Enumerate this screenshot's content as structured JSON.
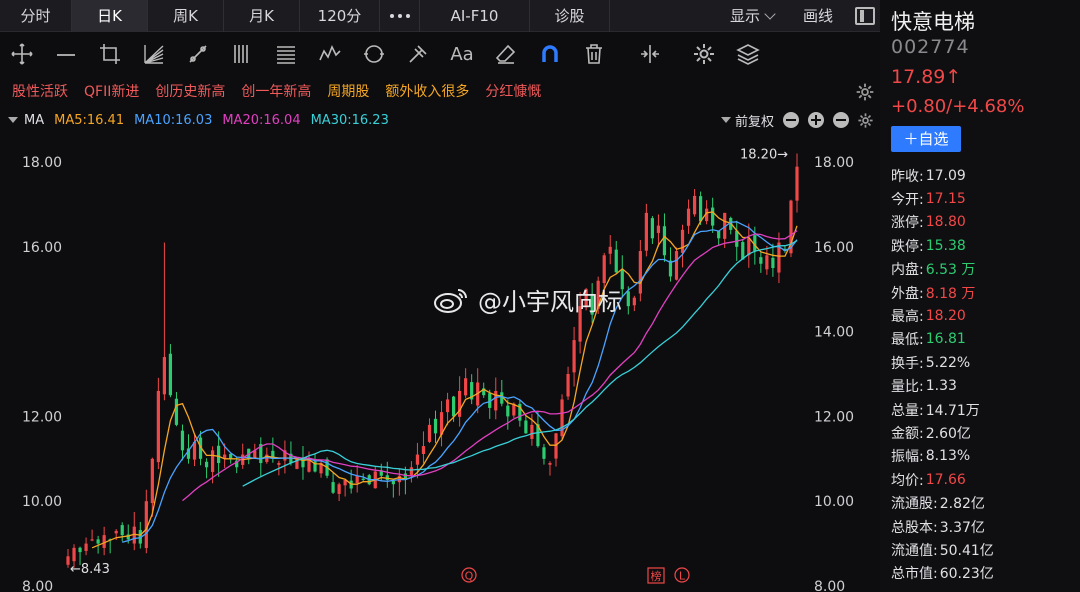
{
  "colors": {
    "up": "#f04848",
    "down": "#2ecc71",
    "ma5": "#f5a623",
    "ma10": "#4aa3ff",
    "ma20": "#e040c0",
    "ma30": "#39d0d8",
    "accent": "#2f7bff",
    "tag": "#f05a5a"
  },
  "tabs": [
    {
      "label": "分时",
      "active": false,
      "w": 72
    },
    {
      "label": "日K",
      "active": true,
      "w": 76
    },
    {
      "label": "周K",
      "active": false,
      "w": 76
    },
    {
      "label": "月K",
      "active": false,
      "w": 76
    },
    {
      "label": "120分",
      "active": false,
      "w": 80
    }
  ],
  "tabs_right": [
    {
      "label": "AI-F10"
    },
    {
      "label": "诊股"
    }
  ],
  "display_label": "显示",
  "draw_label": "画线",
  "toolbar_icons": [
    "crosshair-icon",
    "horizontal-line-icon",
    "crop-icon",
    "fan-icon",
    "pencil-node-icon",
    "parallel-lines-icon",
    "fib-levels-icon",
    "wave-icon",
    "ellipse-icon",
    "pitchfork-icon",
    "text-icon",
    "eraser-icon",
    "magnet-icon",
    "trash-icon",
    "split-icon",
    "gear-icon",
    "layers-icon"
  ],
  "text_tool_label": "Aa",
  "tags": [
    "股性活跃",
    "QFII新进",
    "创历史新高",
    "创一年新高",
    "周期股",
    "额外收入很多",
    "分红慷慨"
  ],
  "ma_row": {
    "label": "MA",
    "items": [
      {
        "text": "MA5:16.41",
        "color": "#f5a623"
      },
      {
        "text": "MA10:16.03",
        "color": "#4aa3ff"
      },
      {
        "text": "MA20:16.04",
        "color": "#e040c0"
      },
      {
        "text": "MA30:16.23",
        "color": "#39d0d8"
      }
    ],
    "adjust": "前复权"
  },
  "watermark": "@小宇风向标",
  "chart_data": {
    "type": "candlestick",
    "y_left_ticks": [
      "18.00",
      "16.00",
      "12.00",
      "10.00",
      "8.00"
    ],
    "y_right_ticks": [
      "18.00",
      "16.00",
      "14.00",
      "12.00",
      "10.00",
      "8.00"
    ],
    "y_tick_values": [
      18,
      16,
      14,
      12,
      10,
      8
    ],
    "ylim": [
      8,
      19
    ],
    "high_label": "18.20→",
    "high_value": 18.2,
    "low_label": "←8.43",
    "low_value": 8.43,
    "markers": [
      "Q",
      "榜",
      "L"
    ],
    "closes": [
      8.7,
      8.9,
      8.8,
      9.0,
      9.1,
      9.0,
      9.2,
      9.1,
      9.3,
      9.2,
      9.1,
      9.4,
      9.0,
      10.0,
      11.0,
      12.6,
      13.4,
      12.5,
      11.8,
      11.2,
      11.0,
      11.4,
      11.0,
      10.8,
      11.2,
      10.9,
      11.1,
      11.0,
      10.8,
      11.1,
      11.0,
      11.2,
      10.9,
      11.1,
      11.0,
      10.9,
      11.2,
      10.9,
      11.0,
      10.8,
      11.0,
      10.7,
      10.9,
      10.6,
      10.2,
      10.4,
      10.5,
      10.3,
      10.6,
      10.5,
      10.4,
      10.7,
      10.6,
      10.5,
      10.4,
      10.6,
      10.5,
      10.8,
      11.1,
      11.3,
      11.8,
      11.6,
      12.1,
      12.4,
      12.0,
      12.6,
      12.9,
      12.4,
      12.8,
      12.5,
      12.2,
      12.6,
      12.3,
      12.0,
      12.3,
      11.9,
      11.6,
      11.8,
      11.3,
      11.0,
      10.9,
      11.6,
      12.4,
      13.0,
      13.8,
      14.6,
      15.0,
      14.4,
      15.2,
      15.8,
      16.0,
      15.4,
      15.0,
      14.6,
      14.8,
      15.9,
      16.8,
      16.2,
      16.5,
      15.8,
      15.3,
      15.9,
      16.4,
      16.9,
      17.2,
      16.6,
      16.9,
      16.5,
      16.2,
      16.8,
      16.4,
      16.0,
      15.7,
      16.2,
      15.9,
      15.6,
      15.8,
      15.5,
      16.1,
      15.9,
      17.09,
      17.89
    ]
  },
  "panel": {
    "name": "快意电梯",
    "code": "002774",
    "price": "17.89↑",
    "change": "+0.80/+4.68%",
    "add_button": "＋自选",
    "stats": [
      {
        "label": "昨收:",
        "value": "17.09",
        "color": "#e0e0e4"
      },
      {
        "label": "今开:",
        "value": "17.15",
        "color": "#f04848"
      },
      {
        "label": "涨停:",
        "value": "18.80",
        "color": "#f04848"
      },
      {
        "label": "跌停:",
        "value": "15.38",
        "color": "#2ecc71"
      },
      {
        "label": "内盘:",
        "value": "6.53 万",
        "color": "#2ecc71"
      },
      {
        "label": "外盘:",
        "value": "8.18 万",
        "color": "#f04848"
      },
      {
        "label": "最高:",
        "value": "18.20",
        "color": "#f04848"
      },
      {
        "label": "最低:",
        "value": "16.81",
        "color": "#2ecc71"
      },
      {
        "label": "换手:",
        "value": "5.22%",
        "color": "#e0e0e4"
      },
      {
        "label": "量比:",
        "value": "1.33",
        "color": "#e0e0e4"
      },
      {
        "label": "总量:",
        "value": "14.71万",
        "color": "#e0e0e4"
      },
      {
        "label": "金额:",
        "value": "2.60亿",
        "color": "#e0e0e4"
      },
      {
        "label": "振幅:",
        "value": "8.13%",
        "color": "#e0e0e4"
      },
      {
        "label": "均价:",
        "value": "17.66",
        "color": "#f04848"
      },
      {
        "label": "流通股:",
        "value": "2.82亿",
        "color": "#e0e0e4"
      },
      {
        "label": "总股本:",
        "value": "3.37亿",
        "color": "#e0e0e4"
      },
      {
        "label": "流通值:",
        "value": "50.41亿",
        "color": "#e0e0e4"
      },
      {
        "label": "总市值:",
        "value": "60.23亿",
        "color": "#e0e0e4"
      }
    ]
  }
}
